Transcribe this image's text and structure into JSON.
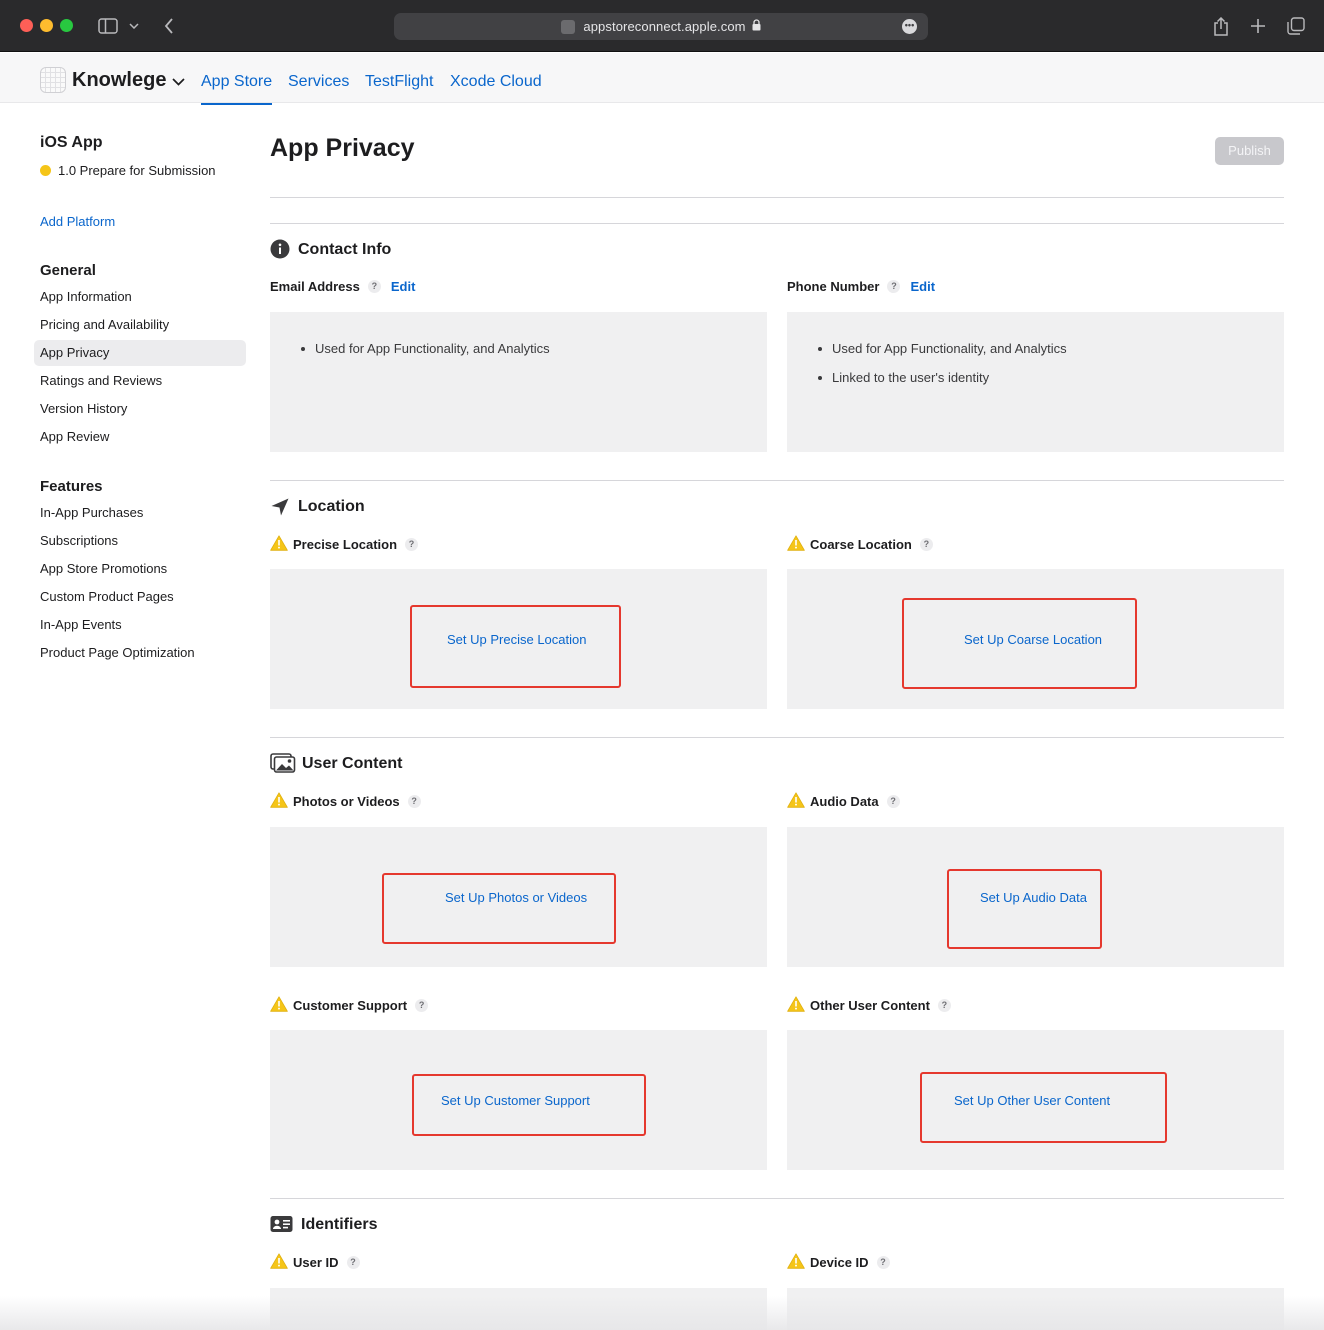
{
  "browser": {
    "url": "appstoreconnect.apple.com"
  },
  "app": {
    "name": "Knowlege",
    "tabs": [
      "App Store",
      "Services",
      "TestFlight",
      "Xcode Cloud"
    ]
  },
  "sidebar": {
    "platform_title": "iOS App",
    "version_status": "1.0 Prepare for Submission",
    "status_color": "#f5c518",
    "add_platform": "Add Platform",
    "sections": [
      {
        "title": "General",
        "items": [
          "App Information",
          "Pricing and Availability",
          "App Privacy",
          "Ratings and Reviews",
          "Version History",
          "App Review"
        ]
      },
      {
        "title": "Features",
        "items": [
          "In-App Purchases",
          "Subscriptions",
          "App Store Promotions",
          "Custom Product Pages",
          "In-App Events",
          "Product Page Optimization"
        ]
      }
    ],
    "selected": "App Privacy"
  },
  "main": {
    "title": "App Privacy",
    "publish_label": "Publish",
    "help_glyph": "?",
    "edit_label": "Edit",
    "contact_info": {
      "title": "Contact Info",
      "email": {
        "label": "Email Address",
        "uses": [
          "Used for App Functionality, and Analytics"
        ]
      },
      "phone": {
        "label": "Phone Number",
        "uses": [
          "Used for App Functionality, and Analytics",
          "Linked to the user's identity"
        ]
      }
    },
    "location": {
      "title": "Location",
      "precise": {
        "label": "Precise Location",
        "action": "Set Up Precise Location"
      },
      "coarse": {
        "label": "Coarse Location",
        "action": "Set Up Coarse Location"
      }
    },
    "user_content": {
      "title": "User Content",
      "photos": {
        "label": "Photos or Videos",
        "action": "Set Up Photos or Videos"
      },
      "audio": {
        "label": "Audio Data",
        "action": "Set Up Audio Data"
      },
      "support": {
        "label": "Customer Support",
        "action": "Set Up Customer Support"
      },
      "other": {
        "label": "Other User Content",
        "action": "Set Up Other User Content"
      }
    },
    "identifiers": {
      "title": "Identifiers",
      "user_id": {
        "label": "User ID"
      },
      "device_id": {
        "label": "Device ID"
      }
    }
  },
  "colors": {
    "accent": "#0a66cc",
    "warning": "#f5c518",
    "highlight": "#e5382e"
  }
}
